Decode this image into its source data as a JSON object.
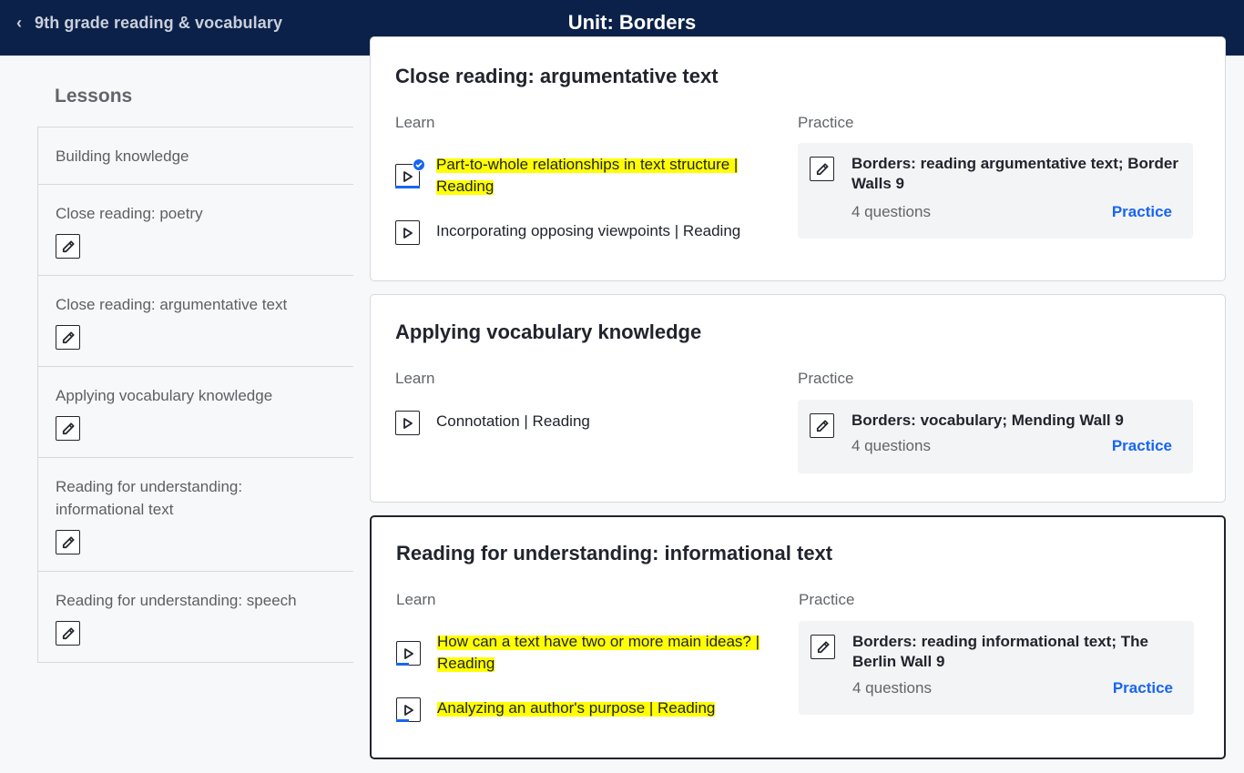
{
  "header": {
    "back_label": "9th grade reading & vocabulary",
    "unit_title": "Unit: Borders"
  },
  "sidebar": {
    "title": "Lessons",
    "items": [
      {
        "label": "Building knowledge",
        "has_practice": false
      },
      {
        "label": "Close reading: poetry",
        "has_practice": true
      },
      {
        "label": "Close reading: argumentative text",
        "has_practice": true
      },
      {
        "label": "Applying vocabulary knowledge",
        "has_practice": true
      },
      {
        "label": "Reading for understanding: informational text",
        "has_practice": true
      },
      {
        "label": "Reading for understanding: speech",
        "has_practice": true
      }
    ]
  },
  "cards": [
    {
      "title": "Close reading: argumentative text",
      "learn_label": "Learn",
      "practice_label": "Practice",
      "learn_items": [
        {
          "text": "Part-to-whole relationships in text structure | Reading",
          "highlighted": true,
          "completed": true,
          "progress": 1.0
        },
        {
          "text": "Incorporating opposing viewpoints | Reading",
          "highlighted": false,
          "completed": false,
          "progress": 0
        }
      ],
      "practice": {
        "title": "Borders: reading argumentative text; Border Walls 9",
        "count": "4 questions",
        "link": "Practice"
      }
    },
    {
      "title": "Applying vocabulary knowledge",
      "learn_label": "Learn",
      "practice_label": "Practice",
      "learn_items": [
        {
          "text": "Connotation | Reading",
          "highlighted": false,
          "completed": false,
          "progress": 0
        }
      ],
      "practice": {
        "title": "Borders: vocabulary; Mending Wall 9",
        "count": "4 questions",
        "link": "Practice"
      }
    },
    {
      "title": "Reading for understanding: informational text",
      "learn_label": "Learn",
      "practice_label": "Practice",
      "learn_items": [
        {
          "text": "How can a text have two or more main ideas? | Reading",
          "highlighted": true,
          "completed": false,
          "progress": 0.5
        },
        {
          "text": "Analyzing an author's purpose | Reading",
          "highlighted": true,
          "completed": false,
          "progress": 0.5
        }
      ],
      "practice": {
        "title": "Borders: reading informational text; The Berlin Wall 9",
        "count": "4 questions",
        "link": "Practice"
      }
    }
  ],
  "colors": {
    "header_bg": "#0b2149",
    "accent": "#1865f2",
    "highlight": "#ffff00"
  },
  "icons": {
    "back": "chevron-left-icon",
    "practice": "pencil-icon",
    "video": "play-icon",
    "completed": "check-icon"
  }
}
